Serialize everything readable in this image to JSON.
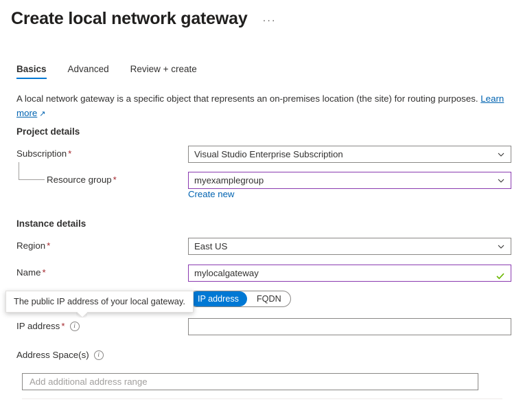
{
  "header": {
    "title": "Create local network gateway",
    "ellipsis_label": "···"
  },
  "tabs": [
    {
      "label": "Basics",
      "active": true
    },
    {
      "label": "Advanced",
      "active": false
    },
    {
      "label": "Review + create",
      "active": false
    }
  ],
  "description": {
    "text": "A local network gateway is a specific object that represents an on-premises location (the site) for routing purposes.",
    "link_text": "Learn more",
    "external_icon": "↗"
  },
  "sections": {
    "project_details": {
      "title": "Project details",
      "subscription": {
        "label": "Subscription",
        "required": "*",
        "value": "Visual Studio Enterprise Subscription"
      },
      "resource_group": {
        "label": "Resource group",
        "required": "*",
        "value": "myexamplegroup",
        "create_new_label": "Create new"
      }
    },
    "instance_details": {
      "title": "Instance details",
      "region": {
        "label": "Region",
        "required": "*",
        "value": "East US"
      },
      "name": {
        "label": "Name",
        "required": "*",
        "value": "mylocalgateway"
      },
      "endpoint_toggle": {
        "options": [
          "IP address",
          "FQDN"
        ],
        "selected": "IP address"
      },
      "ip_address": {
        "label": "IP address",
        "required": "*",
        "value": "",
        "placeholder": "",
        "info_icon": "i"
      },
      "address_spaces": {
        "label": "Address Space(s)",
        "info_icon": "i",
        "value": "",
        "placeholder": "Add additional address range"
      }
    }
  },
  "tooltip": {
    "text": "The public IP address of your local gateway."
  },
  "colors": {
    "accent": "#0078d4",
    "link": "#0063b1",
    "required": "#a4262c",
    "focus_border": "#8a3ab0",
    "valid_check": "#6bb700",
    "border": "#8a8886"
  }
}
